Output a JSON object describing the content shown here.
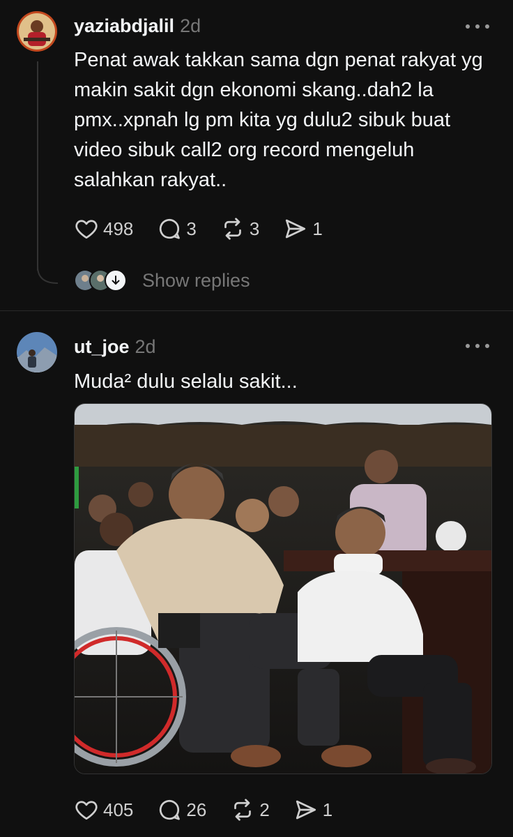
{
  "posts": [
    {
      "username": "yaziabdjalil",
      "time": "2d",
      "text": "Penat awak takkan sama dgn penat rakyat yg makin sakit dgn ekonomi skang..dah2 la pmx..xpnah lg pm kita yg dulu2 sibuk buat video sibuk call2 org record mengeluh salahkan rakyat..",
      "likes": "498",
      "replies": "3",
      "reposts": "3",
      "shares": "1",
      "show_replies": "Show replies"
    },
    {
      "username": "ut_joe",
      "time": "2d",
      "text": "Muda² dulu selalu sakit...",
      "likes": "405",
      "replies": "26",
      "reposts": "2",
      "shares": "1"
    }
  ],
  "icons": {
    "like": "heart-icon",
    "reply": "comment-icon",
    "repost": "repost-icon",
    "share": "send-icon",
    "more": "more-icon",
    "expand": "arrow-down-icon"
  },
  "colors": {
    "background": "#101010",
    "text": "#f3f5f7",
    "muted": "#777777"
  }
}
